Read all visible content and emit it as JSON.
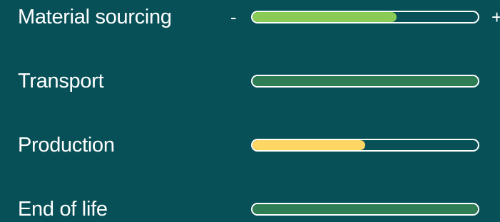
{
  "impact_bars": [
    {
      "label": "Material sourcing",
      "fill_percent": 64,
      "fill_color": "#8ACB55",
      "show_controls": true,
      "decrease_label": "-",
      "increase_label": "+"
    },
    {
      "label": "Transport",
      "fill_percent": 100,
      "fill_color": "#2E7D55",
      "show_controls": false
    },
    {
      "label": "Production",
      "fill_percent": 50,
      "fill_color": "#FDD663",
      "show_controls": false
    },
    {
      "label": "End of life",
      "fill_percent": 100,
      "fill_color": "#2E7D55",
      "show_controls": false
    }
  ],
  "colors": {
    "background": "#075057",
    "text": "#FFFFFF",
    "bar_outline": "#FFFFFF"
  }
}
